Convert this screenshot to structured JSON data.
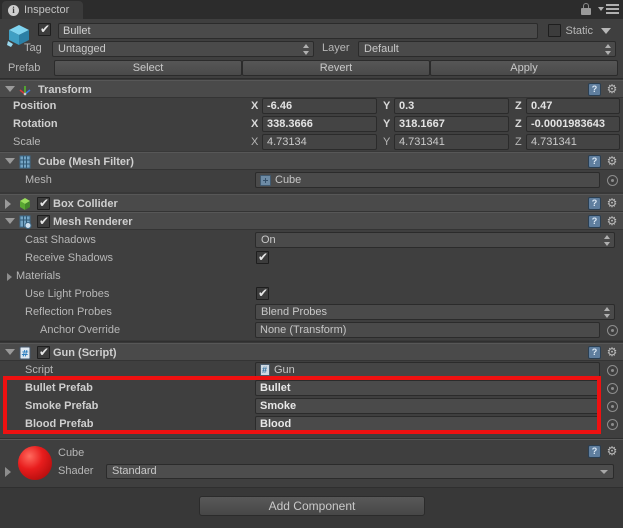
{
  "window": {
    "tab_label": "Inspector",
    "tab_icon": "info-icon",
    "lock_icon": "lock-icon",
    "menu_icon": "hamburger-menu-icon"
  },
  "object_header": {
    "icon": "prefab-cube-icon",
    "enabled": true,
    "name": "Bullet",
    "static_label": "Static",
    "static_checked": false,
    "tag_label": "Tag",
    "tag_value": "Untagged",
    "layer_label": "Layer",
    "layer_value": "Default",
    "prefab_label": "Prefab",
    "prefab_select": "Select",
    "prefab_revert": "Revert",
    "prefab_apply": "Apply"
  },
  "components": [
    {
      "id": "transform",
      "title": "Transform",
      "icon": "transform-axis-icon",
      "expanded": true,
      "has_checkbox": false,
      "rows": [
        {
          "label": "Position",
          "bold": true,
          "x": "-6.46",
          "y": "0.3",
          "z": "0.47"
        },
        {
          "label": "Rotation",
          "bold": true,
          "x": "338.3666",
          "y": "318.1667",
          "z": "-0.0001983643"
        },
        {
          "label": "Scale",
          "bold": false,
          "x": "4.73134",
          "y": "4.731341",
          "z": "4.731341"
        }
      ],
      "axis_labels": [
        "X",
        "Y",
        "Z"
      ]
    },
    {
      "id": "mesh-filter",
      "title": "Cube (Mesh Filter)",
      "icon": "mesh-filter-icon",
      "expanded": true,
      "has_checkbox": false,
      "mesh_label": "Mesh",
      "mesh_value": "Cube"
    },
    {
      "id": "box-collider",
      "title": "Box Collider",
      "icon": "box-collider-icon",
      "expanded": false,
      "has_checkbox": true,
      "checked": true
    },
    {
      "id": "mesh-renderer",
      "title": "Mesh Renderer",
      "icon": "mesh-renderer-icon",
      "expanded": true,
      "has_checkbox": true,
      "checked": true,
      "fields": {
        "cast_shadows_label": "Cast Shadows",
        "cast_shadows_value": "On",
        "receive_shadows_label": "Receive Shadows",
        "receive_shadows_checked": true,
        "materials_label": "Materials",
        "use_light_probes_label": "Use Light Probes",
        "use_light_probes_checked": true,
        "reflection_probes_label": "Reflection Probes",
        "reflection_probes_value": "Blend Probes",
        "anchor_override_label": "Anchor Override",
        "anchor_override_value": "None (Transform)"
      }
    },
    {
      "id": "gun-script",
      "title": "Gun (Script)",
      "icon": "csharp-script-icon",
      "expanded": true,
      "has_checkbox": true,
      "checked": true,
      "fields": {
        "script_label": "Script",
        "script_value": "Gun",
        "bullet_prefab_label": "Bullet Prefab",
        "bullet_prefab_value": "Bullet",
        "smoke_prefab_label": "Smoke Prefab",
        "smoke_prefab_value": "Smoke",
        "blood_prefab_label": "Blood Prefab",
        "blood_prefab_value": "Blood"
      }
    }
  ],
  "annotation": {
    "color": "#ee1111",
    "target": "prefab-reference-fields"
  },
  "material": {
    "name": "Cube",
    "preview_color": "#e81d1d",
    "shader_label": "Shader",
    "shader_value": "Standard"
  },
  "footer": {
    "add_component_label": "Add Component"
  }
}
